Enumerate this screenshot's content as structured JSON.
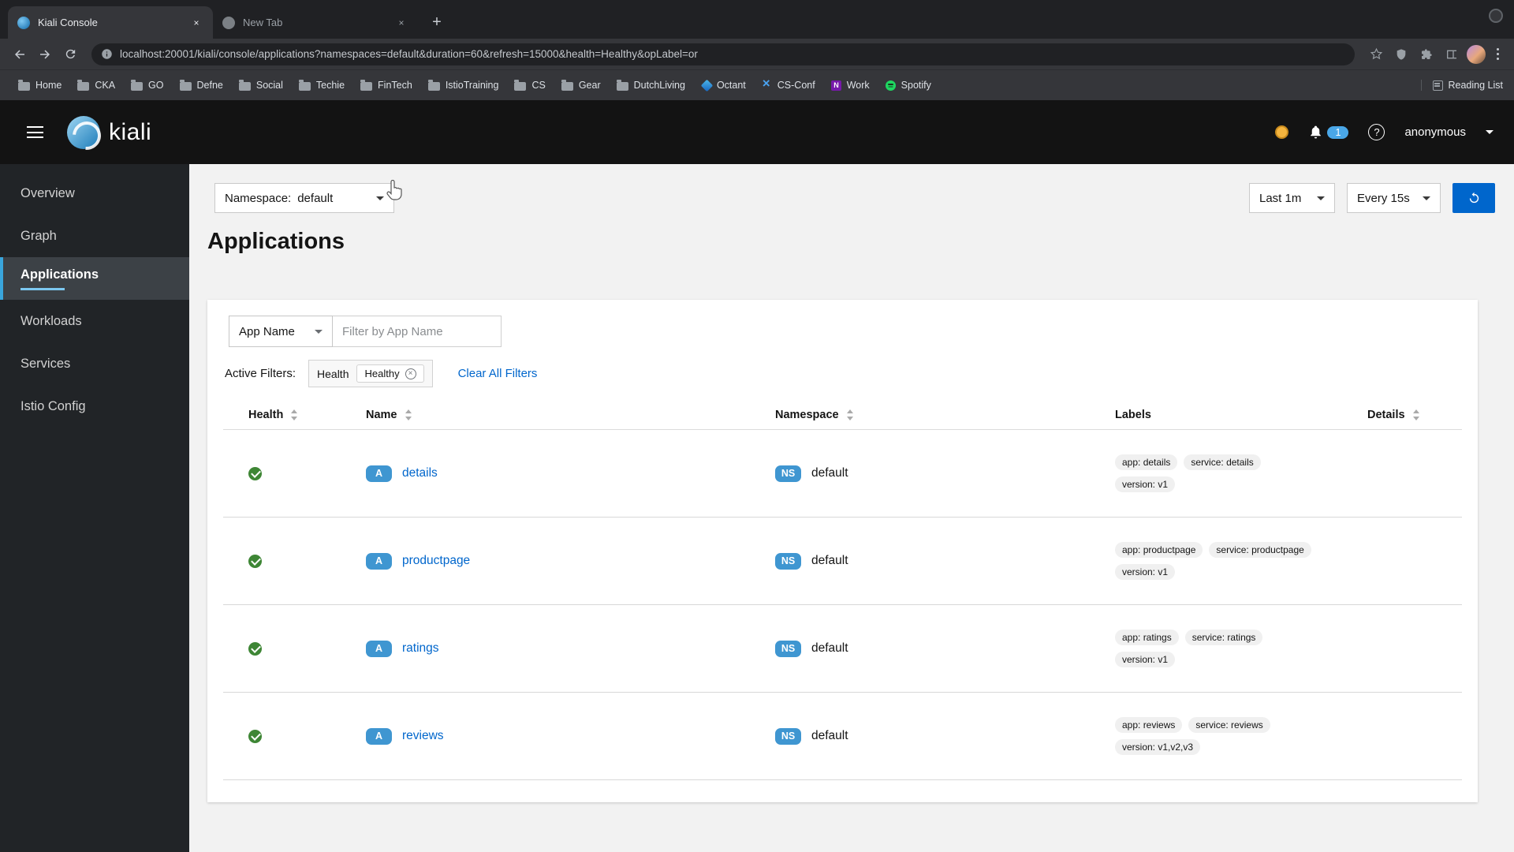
{
  "browser": {
    "tabs": [
      {
        "title": "Kiali Console"
      },
      {
        "title": "New Tab"
      }
    ],
    "url": "localhost:20001/kiali/console/applications?namespaces=default&duration=60&refresh=15000&health=Healthy&opLabel=or",
    "bookmarks": [
      {
        "label": "Home",
        "icon": "folder"
      },
      {
        "label": "CKA",
        "icon": "folder"
      },
      {
        "label": "GO",
        "icon": "folder"
      },
      {
        "label": "Defne",
        "icon": "folder"
      },
      {
        "label": "Social",
        "icon": "folder"
      },
      {
        "label": "Techie",
        "icon": "folder"
      },
      {
        "label": "FinTech",
        "icon": "folder"
      },
      {
        "label": "IstioTraining",
        "icon": "folder"
      },
      {
        "label": "CS",
        "icon": "folder"
      },
      {
        "label": "Gear",
        "icon": "folder"
      },
      {
        "label": "DutchLiving",
        "icon": "folder"
      },
      {
        "label": "Octant",
        "icon": "octant"
      },
      {
        "label": "CS-Conf",
        "icon": "csconf"
      },
      {
        "label": "Work",
        "icon": "onenote"
      },
      {
        "label": "Spotify",
        "icon": "spotify"
      }
    ],
    "reading_list_label": "Reading List"
  },
  "masthead": {
    "brand": "kiali",
    "notification_count": "1",
    "username": "anonymous"
  },
  "sidebar": {
    "items": [
      {
        "label": "Overview",
        "state": ""
      },
      {
        "label": "Graph",
        "state": ""
      },
      {
        "label": "Applications",
        "state": "active"
      },
      {
        "label": "Workloads",
        "state": ""
      },
      {
        "label": "Services",
        "state": ""
      },
      {
        "label": "Istio Config",
        "state": ""
      }
    ]
  },
  "toolbar": {
    "namespace_label": "Namespace:",
    "namespace_value": "default",
    "duration": "Last 1m",
    "refresh_interval": "Every 15s"
  },
  "page_title": "Applications",
  "filters": {
    "type": "App Name",
    "placeholder": "Filter by App Name",
    "active_filters_label": "Active Filters:",
    "group_label": "Health",
    "chip": "Healthy",
    "clear_all": "Clear All Filters"
  },
  "table": {
    "headers": [
      {
        "label": "Health",
        "col": "col-health",
        "sortable": "sortable"
      },
      {
        "label": "Name",
        "col": "col-name",
        "sortable": "sortable"
      },
      {
        "label": "Namespace",
        "col": "col-namespace",
        "sortable": "sortable"
      },
      {
        "label": "Labels",
        "col": "col-labels",
        "sortable": ""
      },
      {
        "label": "Details",
        "col": "col-details",
        "sortable": "sortable"
      }
    ],
    "rows": [
      {
        "badge": "A",
        "name": "details",
        "ns_badge": "NS",
        "namespace": "default",
        "labels": [
          "app: details",
          "service: details",
          "version: v1"
        ]
      },
      {
        "badge": "A",
        "name": "productpage",
        "ns_badge": "NS",
        "namespace": "default",
        "labels": [
          "app: productpage",
          "service: productpage",
          "version: v1"
        ]
      },
      {
        "badge": "A",
        "name": "ratings",
        "ns_badge": "NS",
        "namespace": "default",
        "labels": [
          "app: ratings",
          "service: ratings",
          "version: v1"
        ]
      },
      {
        "badge": "A",
        "name": "reviews",
        "ns_badge": "NS",
        "namespace": "default",
        "labels": [
          "app: reviews",
          "service: reviews",
          "version: v1,v2,v3"
        ]
      }
    ]
  },
  "colors": {
    "accent_blue": "#0066cc",
    "healthy_green": "#3e8635",
    "badge_blue": "#3f96d1",
    "warning_amber": "#f5b53f",
    "masthead_black": "#131313",
    "sidebar_dark": "#212427"
  }
}
